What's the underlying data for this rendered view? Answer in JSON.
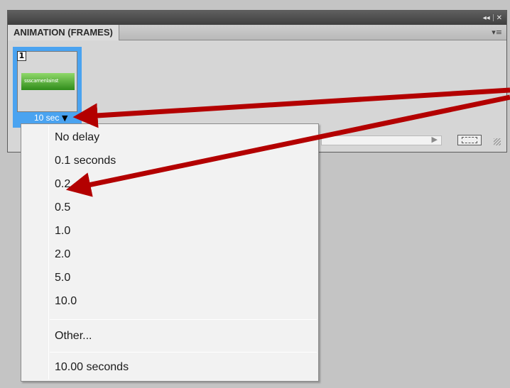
{
  "panel": {
    "title_controls": [
      "◂◂",
      "✕"
    ],
    "tab_label": "ANIMATION (FRAMES)",
    "menu_glyph": "▾≡"
  },
  "frame": {
    "number": "1",
    "thumbnail_text": "ssscamenlainst",
    "delay_label": "10 sec",
    "delay_arrow": "▼"
  },
  "delay_menu": {
    "items": [
      "No delay",
      "0.1 seconds",
      "0.2",
      "0.5",
      "1.0",
      "2.0",
      "5.0",
      "10.0"
    ],
    "other": "Other...",
    "current": "10.00 seconds"
  },
  "colors": {
    "selection_blue": "#4aa3f0",
    "arrow_red": "#b30000",
    "thumbnail_green": "#2f8c1a"
  },
  "icons": [
    "collapse-icon",
    "close-icon",
    "panel-menu-icon",
    "dropdown-arrow-icon",
    "new-frame-icon",
    "resize-grip-icon"
  ]
}
